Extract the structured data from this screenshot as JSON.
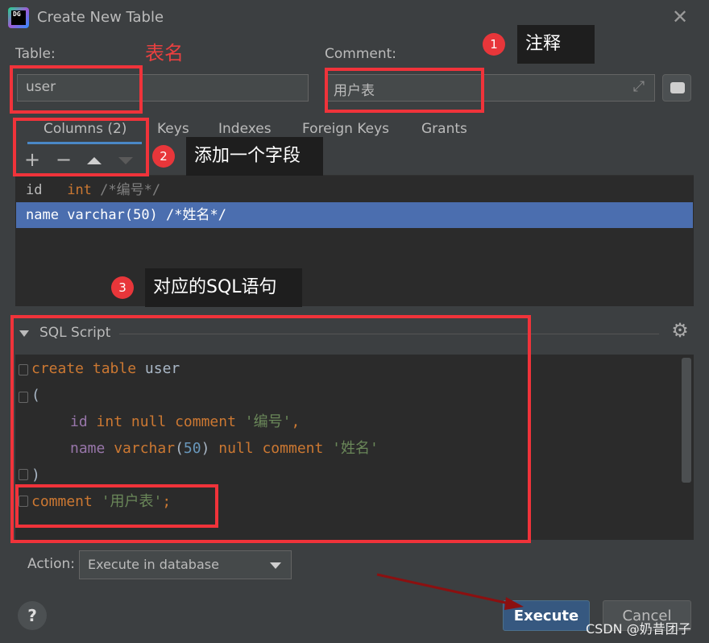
{
  "window": {
    "title": "Create New Table",
    "logo_text": "DG"
  },
  "table": {
    "label": "Table:",
    "value": "user",
    "annotation": "表名"
  },
  "comment": {
    "label": "Comment:",
    "value": "用户表"
  },
  "callouts": [
    {
      "badge": "1",
      "text": "注释"
    },
    {
      "badge": "2",
      "text": "添加一个字段"
    },
    {
      "badge": "3",
      "text": "对应的SQL语句"
    }
  ],
  "tabs": [
    "Columns (2)",
    "Keys",
    "Indexes",
    "Foreign Keys",
    "Grants"
  ],
  "columns": [
    {
      "name": "id",
      "type": "int",
      "comment": "/*编号*/"
    },
    {
      "name": "name",
      "type": "varchar(50)",
      "comment": "/*姓名*/"
    }
  ],
  "sql": {
    "header": "SQL Script",
    "lines": {
      "l1_kw": "create table",
      "l1_name": "user",
      "l2": "(",
      "l3_col": "id",
      "l3_kw": "int null comment",
      "l3_str": "'编号'",
      "l3_end": ",",
      "l4_col": "name",
      "l4_kw": "varchar",
      "l4_open": "(",
      "l4_num": "50",
      "l4_close": ")",
      "l4_kw2": "null comment",
      "l4_str": "'姓名'",
      "l5": ")",
      "l6_kw": "comment",
      "l6_str": "'用户表'",
      "l6_end": ";"
    }
  },
  "action": {
    "label": "Action:",
    "selected": "Execute in database"
  },
  "buttons": {
    "help": "?",
    "execute": "Execute",
    "cancel": "Cancel"
  },
  "watermark": "CSDN @奶昔团子"
}
